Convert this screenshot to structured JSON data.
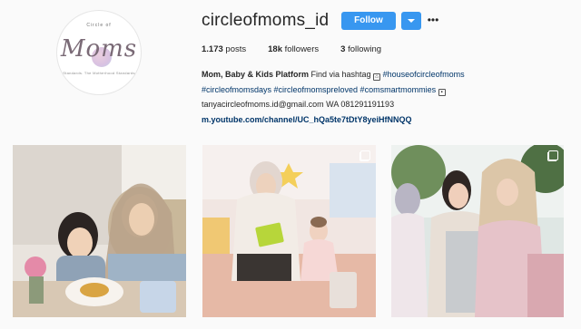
{
  "profile": {
    "username": "circleofmoms_id",
    "follow_label": "Follow",
    "more_label": "•••",
    "avatar": {
      "top_text": "Circle of",
      "main_text": "Moms",
      "bottom_text": "Standards. The Motherhood Standards"
    }
  },
  "stats": {
    "posts_count": "1.173",
    "posts_label": "posts",
    "followers_count": "18k",
    "followers_label": "followers",
    "following_count": "3",
    "following_label": "following"
  },
  "bio": {
    "name": "Mom, Baby & Kids Platform",
    "line1_text": "Find via hashtag",
    "line1_tag": "#houseofcircleofmoms",
    "line2_tags": "#circleofmomsdays #circleofmomspreloved #comsmartmommies",
    "line3": "tanyacircleofmoms.id@gmail.com WA 081291191193",
    "link": "m.youtube.com/channel/UC_hQa5te7tDtY8yeiHfNNQQ"
  },
  "colors": {
    "accent": "#3897f0",
    "link": "#003569",
    "background": "#fafafa"
  },
  "posts": [
    {
      "type": "photo",
      "multi": false
    },
    {
      "type": "photo",
      "multi": true
    },
    {
      "type": "photo",
      "multi": true
    }
  ]
}
